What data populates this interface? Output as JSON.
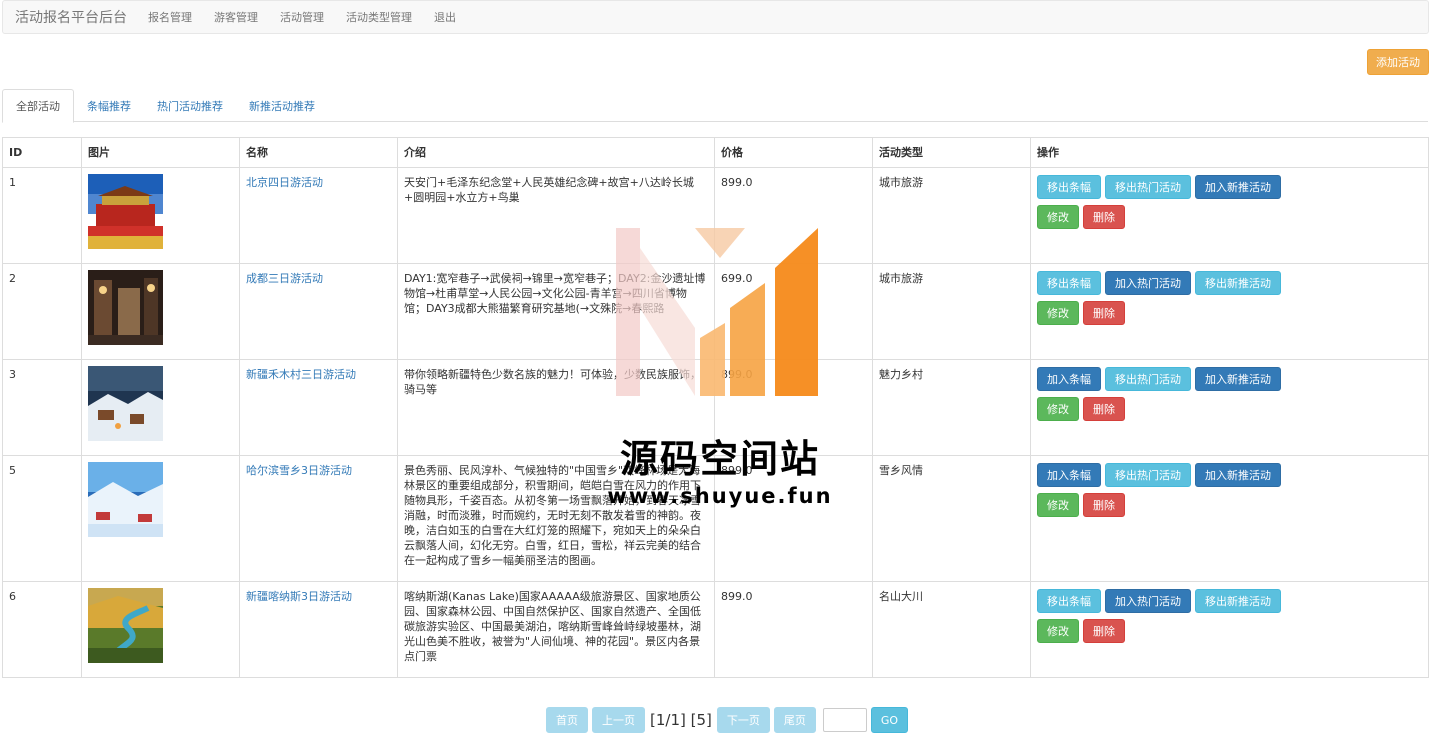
{
  "navbar": {
    "brand": "活动报名平台后台",
    "items": [
      "报名管理",
      "游客管理",
      "活动管理",
      "活动类型管理",
      "退出"
    ]
  },
  "toolbar": {
    "add_label": "添加活动"
  },
  "tabs": [
    "全部活动",
    "条幅推荐",
    "热门活动推荐",
    "新推活动推荐"
  ],
  "table": {
    "headers": [
      "ID",
      "图片",
      "名称",
      "介绍",
      "价格",
      "活动类型",
      "操作"
    ],
    "rows": [
      {
        "id": "1",
        "name": "北京四日游活动",
        "intro": "天安门+毛泽东纪念堂+人民英雄纪念碑+故宫+八达岭长城+圆明园+水立方+鸟巢",
        "price": "899.0",
        "type": "城市旅游",
        "banner_btn": "移出条幅",
        "hot_btn": "移出热门活动",
        "new_btn": "加入新推活动",
        "edit": "修改",
        "delete": "删除"
      },
      {
        "id": "2",
        "name": "成都三日游活动",
        "intro": "DAY1:宽窄巷子→武侯祠→锦里→宽窄巷子；DAY2:金沙遗址博物馆→杜甫草堂→人民公园→文化公园-青羊宫→四川省博物馆；DAY3成都大熊猫繁育研究基地(→文殊院→春熙路",
        "price": "699.0",
        "type": "城市旅游",
        "banner_btn": "移出条幅",
        "hot_btn": "加入热门活动",
        "new_btn": "移出新推活动",
        "edit": "修改",
        "delete": "删除"
      },
      {
        "id": "3",
        "name": "新疆禾木村三日游活动",
        "intro": "带你领略新疆特色少数名族的魅力！可体验，少数民族服饰，骑马等",
        "price": "899.0",
        "type": "魅力乡村",
        "banner_btn": "加入条幅",
        "hot_btn": "移出热门活动",
        "new_btn": "加入新推活动",
        "edit": "修改",
        "delete": "删除"
      },
      {
        "id": "5",
        "name": "哈尔滨雪乡3日游活动",
        "intro": "景色秀丽、民风淳朴、气候独特的\"中国雪乡\"双峰林场是大海林景区的重要组成部分，积雪期间，皑皑白雪在风力的作用下随物具形，千姿百态。从初冬第一场雪飘落开始，到春天冰雪消融，时而淡雅，时而婉约，无时无刻不散发着雪的神韵。夜晚，洁白如玉的白雪在大红灯笼的照耀下，宛如天上的朵朵白云飘落人间，幻化无穷。白雪，红日，雪松，祥云完美的结合在一起构成了雪乡一幅美丽圣洁的图画。",
        "price": "899.0",
        "type": "雪乡风情",
        "banner_btn": "加入条幅",
        "hot_btn": "移出热门活动",
        "new_btn": "加入新推活动",
        "edit": "修改",
        "delete": "删除"
      },
      {
        "id": "6",
        "name": "新疆喀纳斯3日游活动",
        "intro": "喀纳斯湖(Kanas Lake)国家AAAAA级旅游景区、国家地质公园、国家森林公园、中国自然保护区、国家自然遗产、全国低碳旅游实验区、中国最美湖泊，喀纳斯雪峰耸峙绿坡墨林，湖光山色美不胜收，被誉为\"人间仙境、神的花园\"。景区内各景点门票",
        "price": "899.0",
        "type": "名山大川",
        "banner_btn": "移出条幅",
        "hot_btn": "加入热门活动",
        "new_btn": "移出新推活动",
        "edit": "修改",
        "delete": "删除"
      }
    ]
  },
  "pagination": {
    "first": "首页",
    "prev": "上一页",
    "status": "[1/1] [5]",
    "next": "下一页",
    "last": "尾页",
    "go": "GO"
  },
  "watermark": {
    "title": "源码空间站",
    "url": "www.shuyue.fun"
  },
  "colors": {
    "link": "#337ab7",
    "info": "#5bc0de",
    "primary": "#337ab7",
    "success": "#5cb85c",
    "danger": "#d9534f",
    "warning": "#f0ad4e"
  }
}
